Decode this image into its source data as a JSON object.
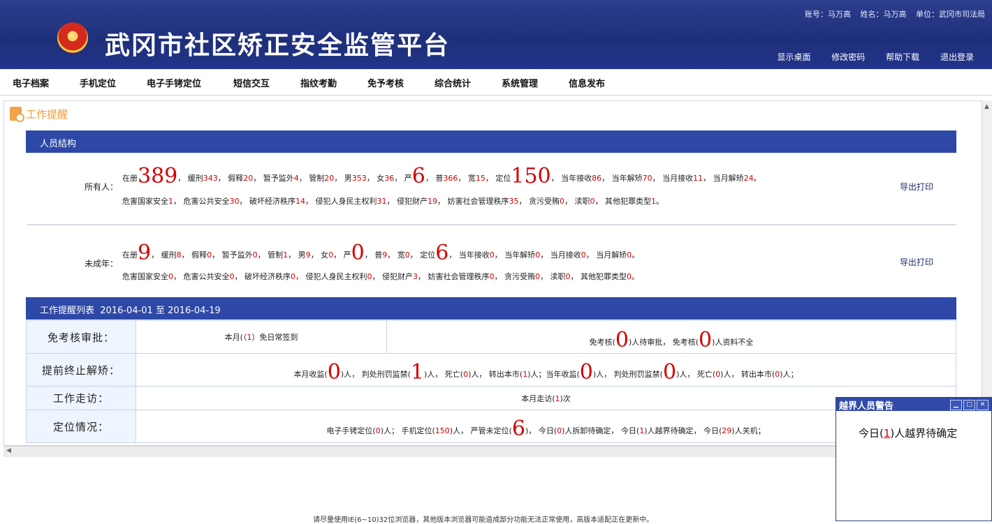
{
  "header": {
    "title": "武冈市社区矫正安全监管平台",
    "account": "账号：马万高",
    "name": "姓名：马万高",
    "unit": "单位：武冈市司法局",
    "links": [
      "显示桌面",
      "修改密码",
      "帮助下载",
      "退出登录"
    ]
  },
  "menu": [
    "电子档案",
    "手机定位",
    "电子手铐定位",
    "短信交互",
    "指纹考勤",
    "免予考核",
    "综合统计",
    "系统管理",
    "信息发布"
  ],
  "panel_title": "工作提醒",
  "structure": {
    "title": "人员结构",
    "export": "导出打印",
    "all": {
      "label": "所有人：",
      "reg_label": "在册",
      "reg": "389",
      "huan_label": "缓刑",
      "huan": "343",
      "jia_label": "假释",
      "jia": "20",
      "zan_label": "暂予监外",
      "zan": "4",
      "guan_label": "管制",
      "guan": "20",
      "nan_label": "男",
      "nan": "353",
      "nv_label": "女",
      "nv": "36",
      "yan_label": "严",
      "yan": "6",
      "pu_label": "普",
      "pu": "366",
      "kuan_label": "宽",
      "kuan": "15",
      "dw_label": "定位",
      "dw": "150",
      "nj_label": "当年接收",
      "nj": "86",
      "nx_label": "当年解矫",
      "nx": "70",
      "yj_label": "当月接收",
      "yj": "11",
      "yx_label": "当月解矫",
      "yx": "24",
      "c1_label": "危害国家安全",
      "c1": "1",
      "c2_label": "危害公共安全",
      "c2": "30",
      "c3_label": "破坏经济秩序",
      "c3": "14",
      "c4_label": "侵犯人身民主权利",
      "c4": "31",
      "c5_label": "侵犯财产",
      "c5": "19",
      "c6_label": "妨害社会管理秩序",
      "c6": "35",
      "c7_label": "贪污受贿",
      "c7": "0",
      "c8_label": "渎职",
      "c8": "0",
      "c9_label": "其他犯罪类型",
      "c9": "1"
    },
    "minor": {
      "label": "未成年：",
      "reg": "9",
      "huan": "8",
      "jia": "0",
      "zan": "0",
      "guan": "1",
      "nan": "9",
      "nv": "0",
      "yan": "0",
      "pu": "9",
      "kuan": "0",
      "dw": "6",
      "nj": "0",
      "nx": "0",
      "yj": "0",
      "yx": "0",
      "c1": "0",
      "c2": "0",
      "c3": "0",
      "c4": "0",
      "c5": "3",
      "c6": "0",
      "c7": "0",
      "c8": "0",
      "c9": "0"
    }
  },
  "reminders": {
    "title": "工作提醒列表",
    "date_from": "2016-04-01",
    "to": "至",
    "date_to": "2016-04-19",
    "exempt": {
      "label": "免考核审批：",
      "monthly_pre": "本月(（",
      "monthly_val": "1",
      "monthly_post": "）免日常签到",
      "pend_pre": "免考核(",
      "pend_val": "0",
      "pend_post": ")人待审批，",
      "inc_pre": "免考核(",
      "inc_val": "0",
      "inc_post": ")人资料不全"
    },
    "terminate": {
      "label": "提前终止解矫：",
      "p1": "本月收监(",
      "v1": "0",
      "p2": ")人，  判处刑罚监禁(",
      "v2": "1",
      "p3": ")人，  死亡(",
      "v3": "0",
      "p4": ")人，  转出本市(",
      "v4": "1",
      "p5": ")人；当年收监(",
      "v5": "0",
      "p6": ")人，  判处刑罚监禁(",
      "v6": "0",
      "p7": ")人，  死亡(",
      "v7": "0",
      "p8": ")人，  转出本市(",
      "v8": "0",
      "p9": ")人；"
    },
    "visit": {
      "label": "工作走访：",
      "pre": "本月走访(",
      "val": "1",
      "post": ")次"
    },
    "location": {
      "label": "定位情况：",
      "p1": "电子手铐定位(",
      "v1": "0",
      "p2": ")人；  手机定位(",
      "v2": "150",
      "p3": ")人，  严管未定位(",
      "v3": "6",
      "p4": ")，  今日(",
      "v4": "0",
      "p5": ")人拆卸待确定，  今日(",
      "v5": "1",
      "p6": ")人越界待确定，  今日(",
      "v6": "29",
      "p7": ")人关机；"
    }
  },
  "popup": {
    "title": "越界人员警告",
    "pre": "今日(",
    "val": "1",
    "post": ")人越界待确定"
  },
  "footer": "请尽量使用IE(6~10)32位浏览器，其他版本浏览器可能造成部分功能无法正常使用，高版本适配正在更新中。"
}
